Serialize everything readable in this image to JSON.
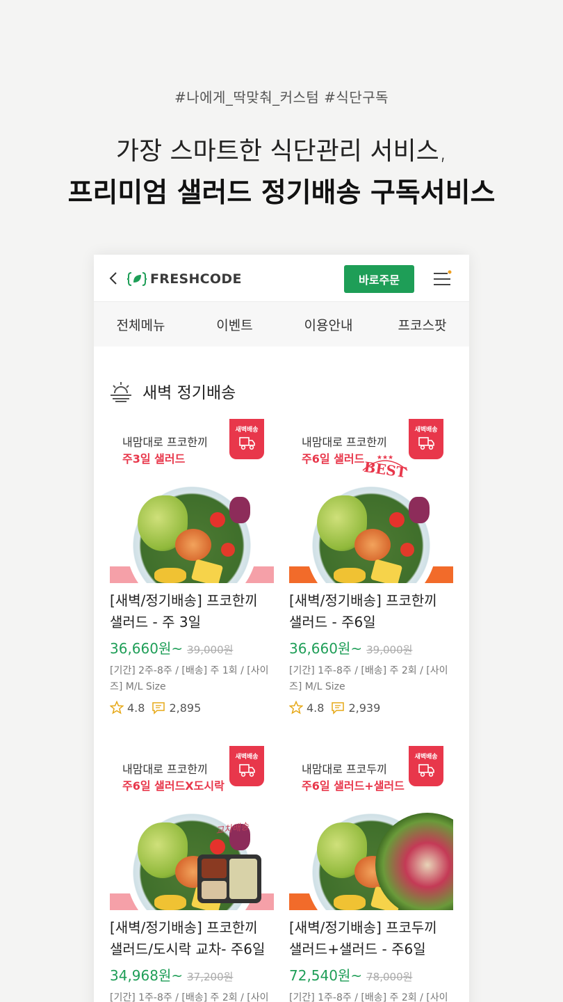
{
  "hero": {
    "tag": "#나에게_딱맞춰_커스텀 #식단구독",
    "line1": "가장 스마트한 식단관리 서비스,",
    "line2": "프리미엄 샐러드 정기배송 구독서비스"
  },
  "header": {
    "logo_text": "FRESHCODE",
    "order_button": "바로주문"
  },
  "nav": {
    "items": [
      "전체메뉴",
      "이벤트",
      "이용안내",
      "프코스팟"
    ]
  },
  "section": {
    "title": "새벽 정기배송"
  },
  "colors": {
    "accent_green": "#1e9e57",
    "badge_red": "#e8374b",
    "band_pink": "#f5a0a8",
    "band_orange": "#f26b2a"
  },
  "products": [
    {
      "promo_line1": "내맘대로 프코한끼",
      "promo_line2": "주3일 샐러드",
      "badge": "새벽배송",
      "name": "[새벽/정기배송] 프코한끼 샐러드 - 주 3일",
      "price": "36,660원~",
      "original_price": "39,000원",
      "meta": "[기간] 2주-8주 / [배송] 주 1회 / [사이즈] M/L Size",
      "rating": "4.8",
      "reviews": "2,895"
    },
    {
      "promo_line1": "내맘대로 프코한끼",
      "promo_line2": "주6일 샐러드",
      "badge": "새벽배송",
      "stamp": "BEST",
      "name": "[새벽/정기배송] 프코한끼 샐러드 - 주6일",
      "price": "36,660원~",
      "original_price": "39,000원",
      "meta": "[기간] 1주-8주 / [배송] 주 2회 / [사이즈] M/L Size",
      "rating": "4.8",
      "reviews": "2,939"
    },
    {
      "promo_line1": "내맘대로 프코한끼",
      "promo_line2": "주6일 샐러드X도시락",
      "badge": "새벽배송",
      "note": "교차배송",
      "name": "[새벽/정기배송] 프코한끼 샐러드/도시락 교차- 주6일",
      "price": "34,968원~",
      "original_price": "37,200원",
      "meta": "[기간] 1주-8주 / [배송] 주 2회 / [사이"
    },
    {
      "promo_line1": "내맘대로 프코두끼",
      "promo_line2": "주6일 샐러드+샐러드",
      "badge": "새벽배송",
      "name": "[새벽/정기배송] 프코두끼 샐러드+샐러드 - 주6일",
      "price": "72,540원~",
      "original_price": "78,000원",
      "meta": "[기간] 1주-8주 / [배송] 주 2회 / [사이"
    }
  ]
}
